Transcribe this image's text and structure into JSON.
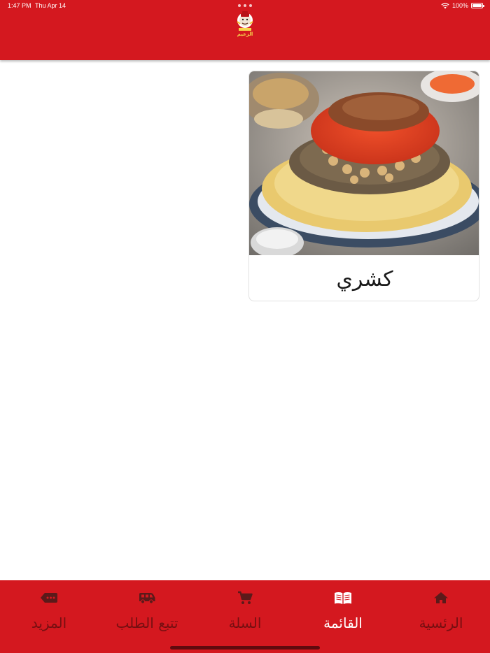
{
  "status_bar": {
    "time": "1:47 PM",
    "date": "Thu Apr 14",
    "battery": "100%"
  },
  "header": {
    "logo_text": "الزعيم",
    "background_color": "#d4181f"
  },
  "menu": {
    "items": [
      {
        "name": "كشري",
        "image": "koshari-plate-image"
      }
    ]
  },
  "tabbar": {
    "active_color": "#ffffff",
    "inactive_color": "#5a1a1a",
    "tabs": [
      {
        "label": "الرئسية",
        "icon": "home-icon",
        "active": false
      },
      {
        "label": "القائمة",
        "icon": "menu-book-icon",
        "active": true
      },
      {
        "label": "السلة",
        "icon": "cart-icon",
        "active": false
      },
      {
        "label": "تتبع الطلب",
        "icon": "delivery-truck-icon",
        "active": false
      },
      {
        "label": "المزيد",
        "icon": "more-tag-icon",
        "active": false
      }
    ]
  }
}
